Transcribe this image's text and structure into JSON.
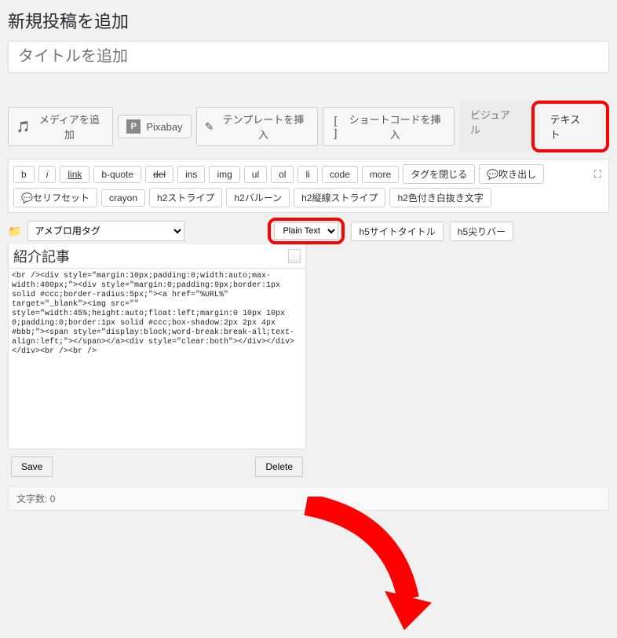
{
  "page": {
    "heading": "新規投稿を追加",
    "title_placeholder": "タイトルを追加"
  },
  "toolbar": {
    "media": "メディアを追加",
    "pixabay": "Pixabay",
    "template": "テンプレートを挿入",
    "shortcode": "ショートコードを挿入"
  },
  "tabs": {
    "visual": "ビジュアル",
    "text": "テキスト"
  },
  "qt": {
    "b": "b",
    "i": "i",
    "link": "link",
    "bquote": "b-quote",
    "del": "del",
    "ins": "ins",
    "img": "img",
    "ul": "ul",
    "ol": "ol",
    "li": "li",
    "code": "code",
    "more": "more",
    "close": "タグを閉じる",
    "balloon": "吹き出し",
    "serif": "セリフセット",
    "crayon": "crayon",
    "h2stripe": "h2ストライプ",
    "h2balloon": "h2バルーン",
    "h2vstripe": "h2縦線ストライプ",
    "h2color": "h2色付き白抜き文字",
    "h5title": "h5サイトタイトル",
    "h5bar": "h5尖りバー"
  },
  "snippet": {
    "select_label": "アメブロ用タグ",
    "mode": "Plain Text",
    "clip_title": "紹介記事",
    "code": "<br /><div style=\"margin:10px;padding:0;width:auto;max-width:400px;\"><div style=\"margin:0;padding:9px;border:1px solid #ccc;border-radius:5px;\"><a href=\"%URL%\" target=\"_blank\"><img src=\"\" style=\"width:45%;height:auto;float:left;margin:0 10px 10px 0;padding:0;border:1px solid #ccc;box-shadow:2px 2px 4px #bbb;\"><span style=\"display:block;word-break:break-all;text-align:left;\"></span></a><div style=\"clear:both\"></div></div></div><br /><br />",
    "save": "Save",
    "delete": "Delete"
  },
  "footer": {
    "charcount_label": "文字数:",
    "charcount_value": "0"
  }
}
